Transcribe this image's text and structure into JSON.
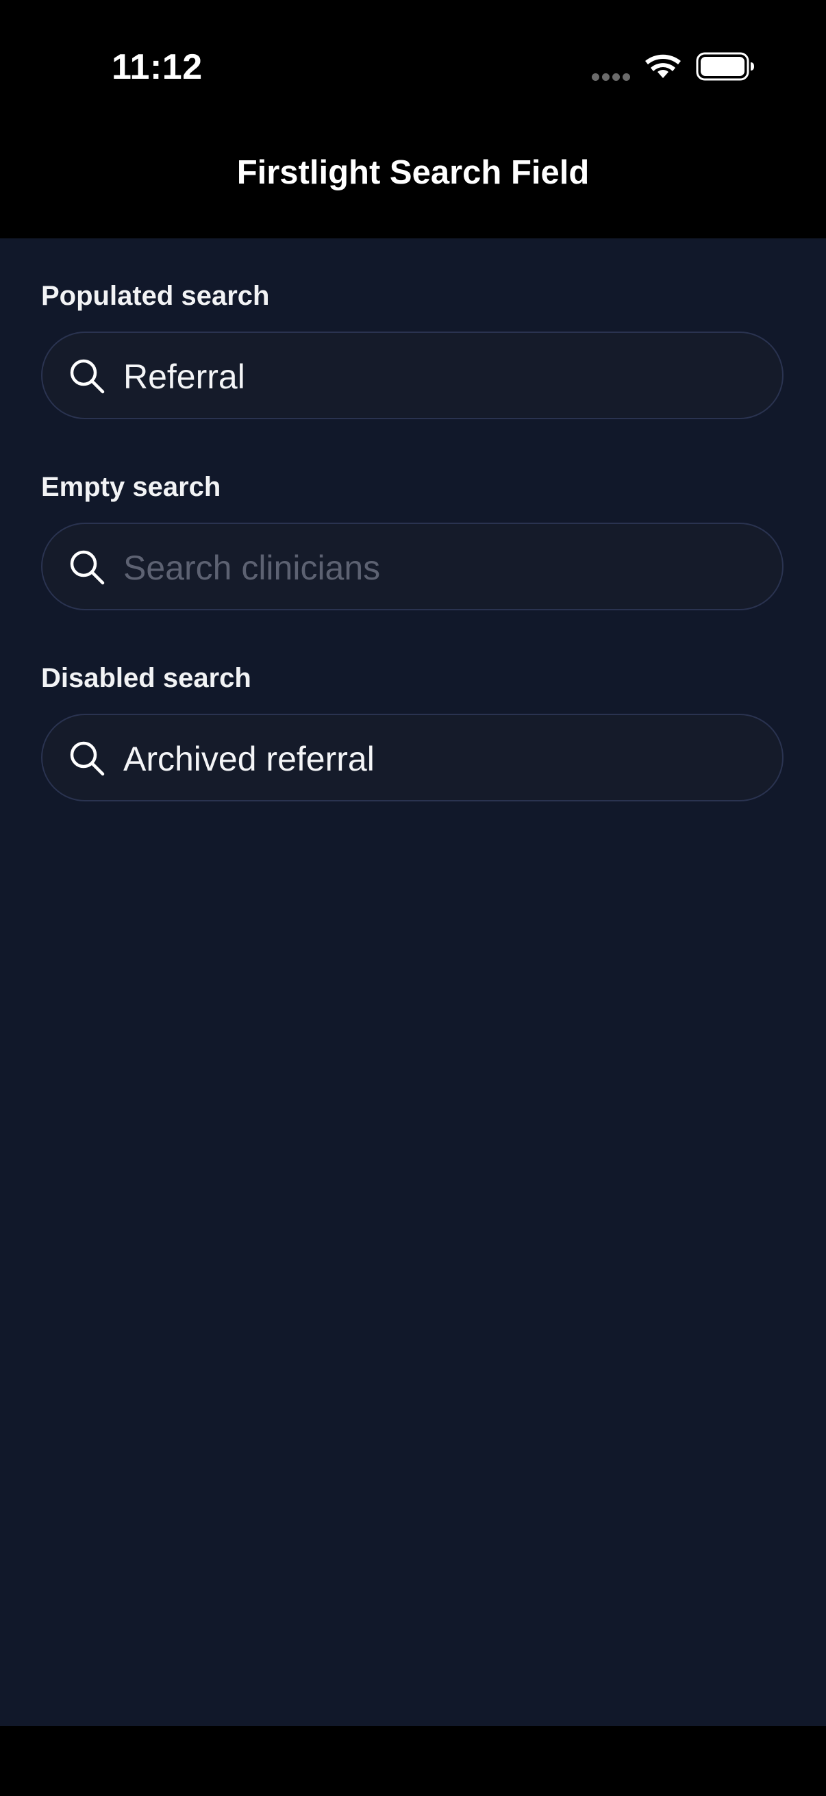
{
  "status_bar": {
    "time": "11:12",
    "wifi_icon": "wifi-icon",
    "battery_icon": "battery-icon"
  },
  "nav": {
    "title": "Firstlight Search Field"
  },
  "sections": [
    {
      "label": "Populated search",
      "value": "Referral",
      "placeholder": "",
      "state": "populated"
    },
    {
      "label": "Empty search",
      "value": "",
      "placeholder": "Search clinicians",
      "state": "empty"
    },
    {
      "label": "Disabled search",
      "value": "Archived referral",
      "placeholder": "",
      "state": "disabled"
    }
  ],
  "colors": {
    "background": "#11182a",
    "field_background": "#151b2a",
    "field_border": "#2a3350",
    "placeholder": "#5d6272",
    "text": "#f4f5f7"
  }
}
